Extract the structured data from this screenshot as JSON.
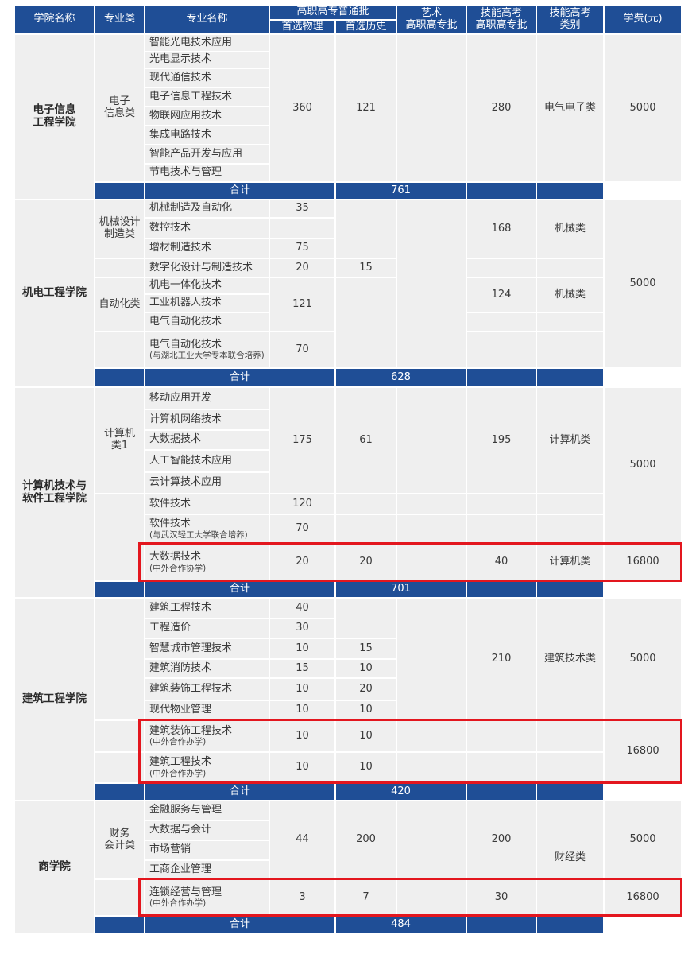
{
  "header": {
    "college": "学院名称",
    "category": "专业类",
    "major": "专业名称",
    "general_batch": "高职高专普通批",
    "physics": "首选物理",
    "history": "首选历史",
    "art_batch": "艺术\n高职高专批",
    "skill_batch": "技能高考\n高职高专批",
    "skill_type": "技能高考\n类别",
    "tuition": "学费(元)"
  },
  "total_label": "合计",
  "colors": {
    "header_bg": "#1f4e96",
    "cell_bg": "#efefef",
    "grid": "#ffffff",
    "highlight": "#e3161e"
  },
  "sections": [
    {
      "college": "电子信息\n工程学院",
      "total": "761",
      "rows": [
        {
          "category": {
            "text": "电子\n信息类",
            "span": 8
          },
          "major": "智能光电技术应用",
          "physics": {
            "text": "360",
            "span": 8
          },
          "history": {
            "text": "121",
            "span": 8
          },
          "art": {
            "text": "",
            "span": 8
          },
          "skill": {
            "text": "280",
            "span": 8
          },
          "skill_type": {
            "text": "电气电子类",
            "span": 8
          },
          "tuition": {
            "text": "5000",
            "span": 8
          }
        },
        {
          "major": "光电显示技术"
        },
        {
          "major": "现代通信技术"
        },
        {
          "major": "电子信息工程技术"
        },
        {
          "major": "物联网应用技术"
        },
        {
          "major": "集成电路技术"
        },
        {
          "major": "智能产品开发与应用"
        },
        {
          "major": "节电技术与管理"
        }
      ]
    },
    {
      "college": "机电工程学院",
      "total": "628",
      "rows": [
        {
          "category": {
            "text": "机械设计\n制造类",
            "span": 3
          },
          "major": "机械制造及自动化",
          "physics": {
            "text": "35",
            "span": 1
          },
          "history": {
            "text": "",
            "span": 3
          },
          "art": {
            "text": "",
            "span": 8
          },
          "skill": {
            "text": "168",
            "span": 3
          },
          "skill_type": {
            "text": "机械类",
            "span": 3
          },
          "tuition": {
            "text": "5000",
            "span": 8
          }
        },
        {
          "major": "数控技术",
          "physics": {
            "text": "",
            "span": 1
          }
        },
        {
          "major": "增材制造技术",
          "physics": {
            "text": "75",
            "span": 1
          }
        },
        {
          "category": {
            "text": "",
            "span": 1
          },
          "major": "数字化设计与制造技术",
          "physics": {
            "text": "20",
            "span": 1
          },
          "history": {
            "text": "15",
            "span": 1
          },
          "skill": {
            "text": "",
            "span": 1
          },
          "skill_type": {
            "text": "",
            "span": 1
          }
        },
        {
          "category": {
            "text": "自动化类",
            "span": 3
          },
          "major": "机电一体化技术",
          "physics": {
            "text": "121",
            "span": 3
          },
          "history": {
            "text": "",
            "span": 4
          },
          "skill": {
            "text": "124",
            "span": 2
          },
          "skill_type": {
            "text": "机械类",
            "span": 2
          }
        },
        {
          "major": "工业机器人技术"
        },
        {
          "major": "电气自动化技术",
          "skill": {
            "text": "",
            "span": 1
          },
          "skill_type": {
            "text": "",
            "span": 1
          }
        },
        {
          "category": {
            "text": "",
            "span": 1
          },
          "major": "电气自动化技术",
          "major_note": "(与湖北工业大学专本联合培养)",
          "physics": {
            "text": "70",
            "span": 1
          },
          "skill": {
            "text": "",
            "span": 1
          },
          "skill_type": {
            "text": "",
            "span": 1
          }
        }
      ]
    },
    {
      "college": "计算机技术与\n软件工程学院",
      "total": "701",
      "rows": [
        {
          "category": {
            "text": "计算机\n类1",
            "span": 5
          },
          "major": "移动应用开发",
          "physics": {
            "text": "175",
            "span": 5
          },
          "history": {
            "text": "61",
            "span": 5
          },
          "art": {
            "text": "",
            "span": 5
          },
          "skill": {
            "text": "195",
            "span": 5
          },
          "skill_type": {
            "text": "计算机类",
            "span": 5
          },
          "tuition": {
            "text": "5000",
            "span": 7
          }
        },
        {
          "major": "计算机网络技术"
        },
        {
          "major": "大数据技术"
        },
        {
          "major": "人工智能技术应用"
        },
        {
          "major": "云计算技术应用"
        },
        {
          "category": {
            "text": "",
            "span": 3
          },
          "major": "软件技术",
          "physics": {
            "text": "120",
            "span": 1
          },
          "history": {
            "text": "",
            "span": 1
          },
          "art": {
            "text": "",
            "span": 1
          },
          "skill": {
            "text": "",
            "span": 1
          },
          "skill_type": {
            "text": "",
            "span": 1
          }
        },
        {
          "major": "软件技术",
          "major_note": "(与武汉轻工大学联合培养)",
          "physics": {
            "text": "70",
            "span": 1
          },
          "history": {
            "text": "",
            "span": 1
          },
          "art": {
            "text": "",
            "span": 1
          },
          "skill": {
            "text": "",
            "span": 1
          },
          "skill_type": {
            "text": "",
            "span": 1
          }
        },
        {
          "major": "大数据技术",
          "major_note": "(中外合作协学)",
          "physics": {
            "text": "20",
            "span": 1
          },
          "history": {
            "text": "20",
            "span": 1
          },
          "art": {
            "text": "",
            "span": 1
          },
          "skill": {
            "text": "40",
            "span": 1
          },
          "skill_type": {
            "text": "计算机类",
            "span": 1
          },
          "tuition": {
            "text": "16800",
            "span": 1
          },
          "highlight": true
        }
      ]
    },
    {
      "college": "建筑工程学院",
      "total": "420",
      "rows": [
        {
          "category": {
            "text": "",
            "span": 6
          },
          "major": "建筑工程技术",
          "physics": {
            "text": "40",
            "span": 1
          },
          "history": {
            "text": "",
            "span": 2
          },
          "art": {
            "text": "",
            "span": 6
          },
          "skill": {
            "text": "210",
            "span": 6
          },
          "skill_type": {
            "text": "建筑技术类",
            "span": 6
          },
          "tuition": {
            "text": "5000",
            "span": 6
          }
        },
        {
          "major": "工程造价",
          "physics": {
            "text": "30",
            "span": 1
          }
        },
        {
          "major": "智慧城市管理技术",
          "physics": {
            "text": "10",
            "span": 1
          },
          "history": {
            "text": "15",
            "span": 1
          }
        },
        {
          "major": "建筑消防技术",
          "physics": {
            "text": "15",
            "span": 1
          },
          "history": {
            "text": "10",
            "span": 1
          }
        },
        {
          "major": "建筑装饰工程技术",
          "physics": {
            "text": "10",
            "span": 1
          },
          "history": {
            "text": "20",
            "span": 1
          }
        },
        {
          "major": "现代物业管理",
          "physics": {
            "text": "10",
            "span": 1
          },
          "history": {
            "text": "10",
            "span": 1
          }
        },
        {
          "category": {
            "text": "",
            "span": 1
          },
          "major": "建筑装饰工程技术",
          "major_note": "(中外合作办学)",
          "physics": {
            "text": "10",
            "span": 1
          },
          "history": {
            "text": "10",
            "span": 1
          },
          "art": {
            "text": "",
            "span": 1
          },
          "skill": {
            "text": "",
            "span": 1
          },
          "skill_type": {
            "text": "",
            "span": 1
          },
          "tuition": {
            "text": "16800",
            "span": 2
          },
          "highlight_start": true
        },
        {
          "category": {
            "text": "",
            "span": 1
          },
          "major": "建筑工程技术",
          "major_note": "(中外合作办学)",
          "physics": {
            "text": "10",
            "span": 1
          },
          "history": {
            "text": "10",
            "span": 1
          },
          "art": {
            "text": "",
            "span": 1
          },
          "skill": {
            "text": "",
            "span": 1
          },
          "skill_type": {
            "text": "",
            "span": 1
          },
          "highlight_end": true
        }
      ]
    },
    {
      "college": "商学院",
      "total": "484",
      "rows": [
        {
          "category": {
            "text": "财务\n会计类",
            "span": 4
          },
          "major": "金融服务与管理",
          "physics": {
            "text": "44",
            "span": 4
          },
          "history": {
            "text": "200",
            "span": 4
          },
          "art": {
            "text": "",
            "span": 4
          },
          "skill": {
            "text": "200",
            "span": 4
          },
          "skill_type": {
            "text": "财经类",
            "span": 5
          },
          "tuition": {
            "text": "5000",
            "span": 4
          }
        },
        {
          "major": "大数据与会计"
        },
        {
          "major": "市场营销"
        },
        {
          "major": "工商企业管理"
        },
        {
          "category": {
            "text": "",
            "span": 1
          },
          "major": "连锁经营与管理",
          "major_note": "(中外合作办学)",
          "physics": {
            "text": "3",
            "span": 1
          },
          "history": {
            "text": "7",
            "span": 1
          },
          "art": {
            "text": "",
            "span": 1
          },
          "skill": {
            "text": "30",
            "span": 1
          },
          "tuition": {
            "text": "16800",
            "span": 1
          },
          "highlight": true
        }
      ]
    }
  ]
}
